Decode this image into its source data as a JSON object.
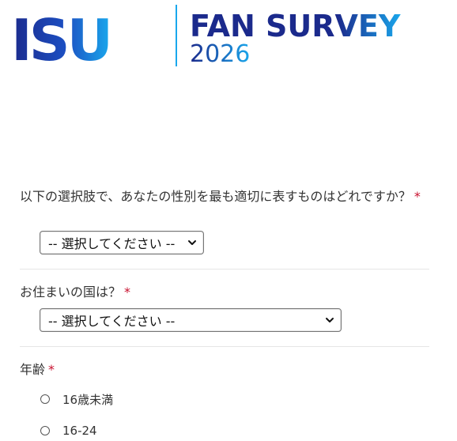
{
  "header": {
    "logo_text": "ISU",
    "title_line1": "FAN SURVEY",
    "title_line2": "2026"
  },
  "colors": {
    "brand_dark": "#1b2a8c",
    "brand_light": "#1aa7ec",
    "required": "#c8102e",
    "text": "#333333",
    "divider": "#e6e6e6"
  },
  "form": {
    "q1": {
      "label": "以下の選択肢で、あなたの性別を最も適切に表すものはどれですか？",
      "required_mark": "*",
      "select_value": "-- 選択してください --"
    },
    "q2": {
      "label": "お住まいの国は？",
      "required_mark": "*",
      "select_value": "-- 選択してください --"
    },
    "q3": {
      "label": "年齢",
      "required_mark": "*",
      "options": [
        "16歳未満",
        "16-24"
      ]
    }
  }
}
